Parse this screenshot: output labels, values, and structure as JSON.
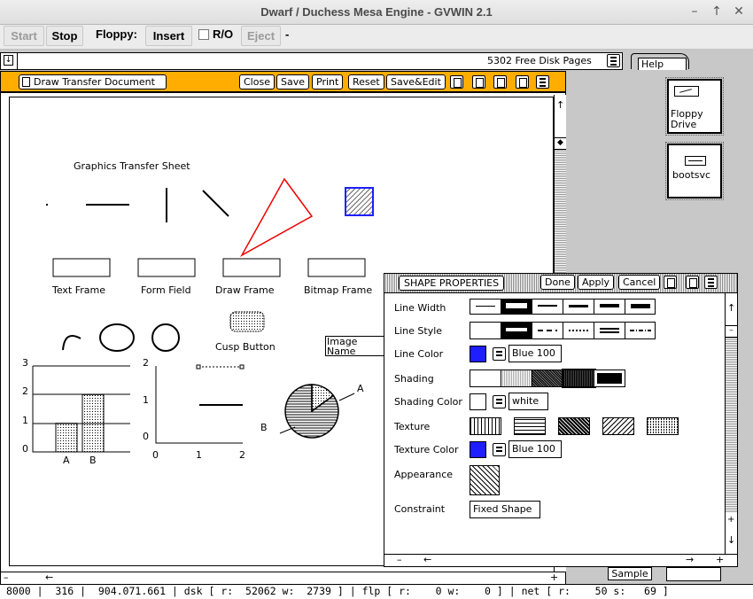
{
  "window": {
    "title": "Dwarf / Duchess Mesa Engine - GVWIN 2.1"
  },
  "toolbar": {
    "start": "Start",
    "stop": "Stop",
    "floppy_label": "Floppy:",
    "insert": "Insert",
    "ro": "R/O",
    "eject": "Eject",
    "dash": "-"
  },
  "topbar": {
    "free_pages": "5302 Free Disk Pages",
    "help_tab": "Help"
  },
  "document": {
    "title": "Draw Transfer Document",
    "buttons": [
      "Close",
      "Save",
      "Print",
      "Reset",
      "Save&Edit"
    ],
    "sheet_title": "Graphics Transfer Sheet",
    "frame_labels": [
      "Text Frame",
      "Form Field",
      "Draw Frame",
      "Bitmap Frame"
    ],
    "cusp_button": "Cusp Button",
    "image_name": "Image Name",
    "bar_chart": {
      "yticks": [
        "3",
        "2",
        "1",
        "0"
      ],
      "categories": [
        "A",
        "B"
      ]
    },
    "line_chart": {
      "yticks": [
        "2",
        "1",
        "0"
      ],
      "xticks": [
        "0",
        "1",
        "2"
      ]
    },
    "pie_chart": {
      "labels": [
        "A",
        "B"
      ]
    }
  },
  "chart_data": [
    {
      "type": "bar",
      "categories": [
        "A",
        "B"
      ],
      "values": [
        1,
        2
      ],
      "ylim": [
        0,
        3
      ]
    },
    {
      "type": "line",
      "x": [
        1,
        2
      ],
      "y": [
        1,
        1
      ],
      "xlim": [
        0,
        2
      ],
      "ylim": [
        0,
        2
      ]
    },
    {
      "type": "pie",
      "labels": [
        "A",
        "B"
      ],
      "values": [
        15,
        85
      ]
    }
  ],
  "side_icons": [
    {
      "label": "Floppy Drive"
    },
    {
      "label": "bootsvc"
    }
  ],
  "shape_properties": {
    "title": "SHAPE PROPERTIES",
    "buttons": {
      "done": "Done",
      "apply": "Apply",
      "cancel": "Cancel"
    },
    "labels": {
      "line_width": "Line Width",
      "line_style": "Line Style",
      "line_color": "Line Color",
      "shading": "Shading",
      "shading_color": "Shading Color",
      "texture": "Texture",
      "texture_color": "Texture Color",
      "appearance": "Appearance",
      "constraint": "Constraint"
    },
    "values": {
      "line_color": "Blue 100",
      "shading_color": "white",
      "texture_color": "Blue 100",
      "constraint": "Fixed Shape"
    },
    "colors": {
      "blue": "#1e1eff"
    }
  },
  "sample": {
    "label": "Sample"
  },
  "status": {
    "text": "8000 |  316 |  904.071.661 | dsk [ r:  52062 w:  2739 ] | flp [ r:    0 w:    0 ] | net [ r:    50 s:   69 ]"
  }
}
